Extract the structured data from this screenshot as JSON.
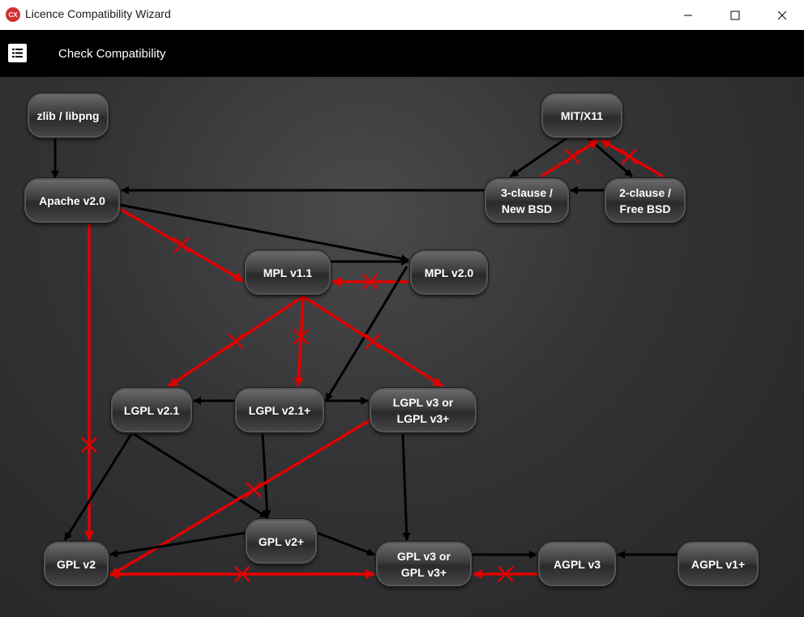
{
  "window": {
    "title": "Licence Compatibility Wizard",
    "app_icon_text": "CX",
    "minimize_icon": "minimize-icon",
    "maximize_icon": "maximize-icon",
    "close_icon": "close-icon"
  },
  "toolbar": {
    "menu_icon": "list-icon",
    "check_label": "Check Compatibility"
  },
  "colors": {
    "compatible_edge": "#000000",
    "incompatible_edge": "#e00000",
    "toolbar_bg": "#000000",
    "node_text": "#ffffff"
  },
  "diagram": {
    "nodes": [
      {
        "id": "zlib",
        "label": "zlib / libpng"
      },
      {
        "id": "mit",
        "label": "MIT/X11"
      },
      {
        "id": "apache",
        "label": "Apache v2.0"
      },
      {
        "id": "bsd3",
        "label": "3-clause /\nNew BSD"
      },
      {
        "id": "bsd2",
        "label": "2-clause /\nFree BSD"
      },
      {
        "id": "mpl11",
        "label": "MPL v1.1"
      },
      {
        "id": "mpl20",
        "label": "MPL v2.0"
      },
      {
        "id": "lgpl21",
        "label": "LGPL v2.1"
      },
      {
        "id": "lgpl21p",
        "label": "LGPL v2.1+"
      },
      {
        "id": "lgpl3",
        "label": "LGPL v3 or\nLGPL v3+"
      },
      {
        "id": "gpl2",
        "label": "GPL v2"
      },
      {
        "id": "gpl2p",
        "label": "GPL v2+"
      },
      {
        "id": "gpl3",
        "label": "GPL v3 or\nGPL v3+"
      },
      {
        "id": "agpl3",
        "label": "AGPL v3"
      },
      {
        "id": "agpl1",
        "label": "AGPL v1+"
      }
    ],
    "edges": [
      {
        "from": "zlib",
        "to": "apache",
        "compatible": true
      },
      {
        "from": "mit",
        "to": "bsd3",
        "compatible": true
      },
      {
        "from": "mit",
        "to": "bsd2",
        "compatible": true
      },
      {
        "from": "bsd3",
        "to": "mit",
        "compatible": false
      },
      {
        "from": "bsd2",
        "to": "mit",
        "compatible": false
      },
      {
        "from": "bsd2",
        "to": "bsd3",
        "compatible": true
      },
      {
        "from": "bsd3",
        "to": "apache",
        "compatible": true
      },
      {
        "from": "apache",
        "to": "mpl20",
        "compatible": true
      },
      {
        "from": "apache",
        "to": "mpl11",
        "compatible": false
      },
      {
        "from": "apache",
        "to": "gpl2",
        "compatible": false
      },
      {
        "from": "mpl11",
        "to": "mpl20",
        "compatible": true
      },
      {
        "from": "mpl20",
        "to": "mpl11",
        "compatible": false
      },
      {
        "from": "mpl20",
        "to": "lgpl21p",
        "compatible": true
      },
      {
        "from": "mpl11",
        "to": "lgpl21",
        "compatible": false
      },
      {
        "from": "mpl11",
        "to": "lgpl21p",
        "compatible": false
      },
      {
        "from": "mpl11",
        "to": "lgpl3",
        "compatible": false
      },
      {
        "from": "lgpl21p",
        "to": "lgpl21",
        "compatible": true
      },
      {
        "from": "lgpl21p",
        "to": "lgpl3",
        "compatible": true
      },
      {
        "from": "lgpl21",
        "to": "gpl2",
        "compatible": true
      },
      {
        "from": "lgpl21",
        "to": "gpl2p",
        "compatible": true
      },
      {
        "from": "lgpl21p",
        "to": "gpl2p",
        "compatible": true
      },
      {
        "from": "lgpl3",
        "to": "gpl2",
        "compatible": false
      },
      {
        "from": "lgpl3",
        "to": "gpl3",
        "compatible": true
      },
      {
        "from": "gpl2p",
        "to": "gpl2",
        "compatible": true
      },
      {
        "from": "gpl2p",
        "to": "gpl3",
        "compatible": true
      },
      {
        "from": "gpl2",
        "to": "gpl3",
        "compatible": false
      },
      {
        "from": "gpl3",
        "to": "gpl2",
        "compatible": false
      },
      {
        "from": "gpl3",
        "to": "agpl3",
        "compatible": true
      },
      {
        "from": "agpl3",
        "to": "gpl3",
        "compatible": false
      },
      {
        "from": "agpl1",
        "to": "agpl3",
        "compatible": true
      }
    ]
  }
}
